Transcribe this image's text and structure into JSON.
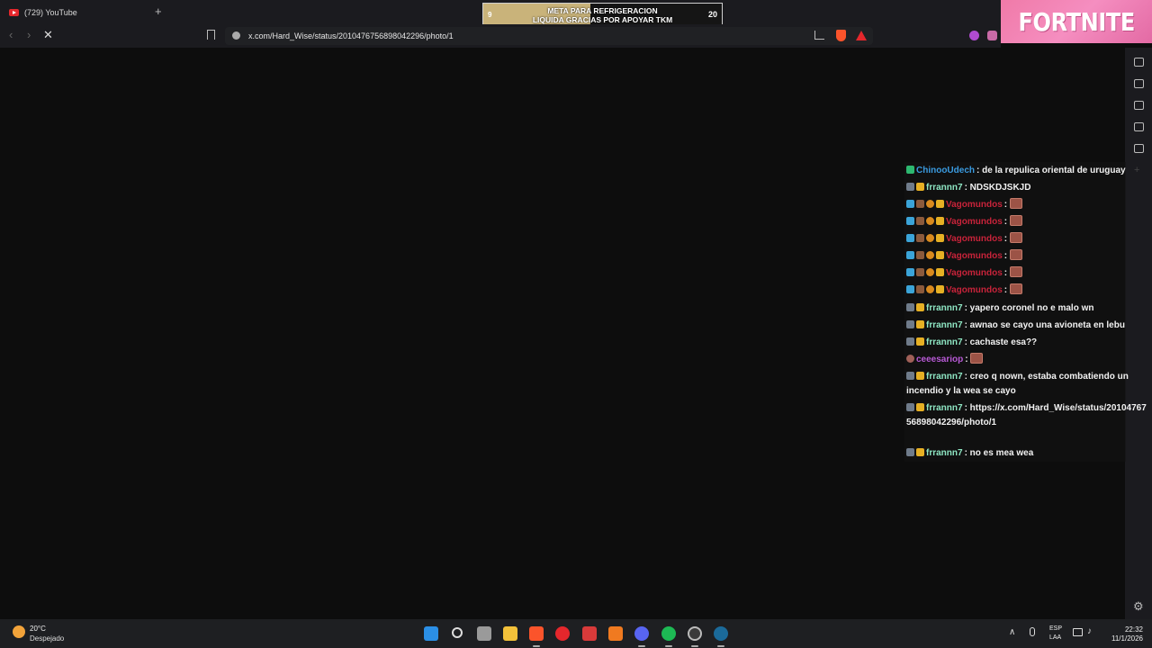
{
  "browser": {
    "tab_title": "(729) YouTube",
    "new_tab_symbol": "+",
    "url": "x.com/Hard_Wise/status/2010476756898042296/photo/1",
    "icons": [
      "youtube-icon",
      "back-icon",
      "forward-icon",
      "stop-icon",
      "bookmark-icon",
      "info-icon",
      "share-icon",
      "brave-shields-icon",
      "brave-rewards-icon"
    ]
  },
  "goal": {
    "start": "9",
    "end": "20",
    "progress_fraction": 0.45,
    "line1": "META PARA REFRIGERACION",
    "line2": "LIQUIDA GRACIAS POR APOYAR TKM"
  },
  "fortnite": {
    "label": "FORTNITE"
  },
  "chat": {
    "messages": [
      {
        "user": "ChinooUdech",
        "text": ": de la repulica oriental de uruguay"
      },
      {
        "user": "frrannn7",
        "text": ": NDSKDJSKJD"
      },
      {
        "user": "Vagomundos",
        "text": ":"
      },
      {
        "user": "Vagomundos",
        "text": ":"
      },
      {
        "user": "Vagomundos",
        "text": ":"
      },
      {
        "user": "Vagomundos",
        "text": ":"
      },
      {
        "user": "Vagomundos",
        "text": ":"
      },
      {
        "user": "Vagomundos",
        "text": ":"
      },
      {
        "user": "frrannn7",
        "text": ": yapero coronel no e malo wn"
      },
      {
        "user": "frrannn7",
        "text": ": awnao se cayo una avioneta en lebu"
      },
      {
        "user": "frrannn7",
        "text": ": cachaste esa??"
      },
      {
        "user": "ceeesariop",
        "text": ":"
      },
      {
        "user": "frrannn7",
        "text": ": creo q nown, estaba combatiendo un incendio y la wea se cayo"
      },
      {
        "user": "frrannn7",
        "text": ": https://x.com/Hard_Wise/status/2010476756898042296/photo/1"
      },
      {
        "user": "frrannn7",
        "text": ": no es mea wea"
      }
    ]
  },
  "taskbar": {
    "weather_temp": "20°C",
    "weather_desc": "Despejado",
    "lang1": "ESP",
    "lang2": "LAA",
    "time": "22:32",
    "date": "11/1/2026",
    "apps": [
      "windows-start-icon",
      "search-icon",
      "task-view-icon",
      "file-explorer-icon",
      "brave-browser-icon",
      "youtube-music-icon",
      "app-red-icon",
      "app-orange-icon",
      "discord-icon",
      "spotify-icon",
      "obs-icon",
      "steam-icon"
    ]
  }
}
